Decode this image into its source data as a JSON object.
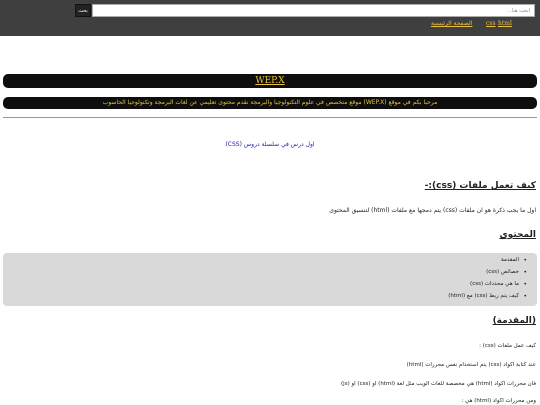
{
  "header": {
    "search_button": "بحث",
    "search_placeholder": "ابحث هنا...",
    "nav": {
      "home": "الصفحة الرئيسية",
      "css": "css",
      "html": "html"
    }
  },
  "brand": {
    "title": "WEP.X",
    "welcome": "مرحبا بكم في موقع (WEP.X) موقع متخصص في علوم التكنولوجيا والبرمجة نقدم محتوى تعليمي عن لغات البرمجة وتكنولوجيا الحاسوب"
  },
  "lesson": {
    "link": "اول درس في سلسلة دروس (CSS)"
  },
  "article": {
    "how_heading": "كيف تعمل ملفات (css):-",
    "how_text": "اول ما يجب ذكرة هو ان ملفات (css) يتم دمجها مع ملفات (html) لتنسيق المحتوى",
    "content_heading": "المحتوي",
    "toc": [
      "المقدمة",
      "خصائص (css)",
      "ما هي محددات (css)",
      "كيف يتم ربط (css) مع (html)"
    ],
    "intro_heading": "(المقدمة)",
    "intro_lines": [
      "كيف عمل ملفات (css) :",
      "عند كتابة اكواد (css) يتم استخدام نفس محررات (html)",
      "فان محررات اكواد (html) هي مخصصة للغات الويب مثل لغة (html) او (css) او (js)",
      "ومن محررات اكواد (html) هي :"
    ]
  }
}
